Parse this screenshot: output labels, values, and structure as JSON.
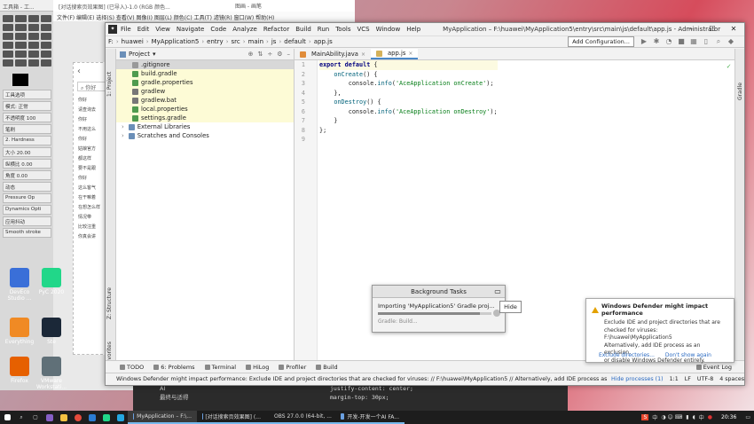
{
  "gimp": {
    "title": "工具箱 - 工...",
    "rows": [
      "工具选项",
      "模式: 正常",
      "不透明度 100",
      "笔刷",
      "2. Hardness",
      "大小 20.00",
      "纵横比 0.00",
      "角度 0.00",
      "动态",
      "Pressure Op",
      "Dynamics Opti",
      "应用抖动",
      "Smooth stroke"
    ]
  },
  "bg_editor": {
    "title": "[对话搜索页效果图] (已导入)-1.0 (RGB 颜色...",
    "menu": "文件(F) 编辑(E) 选择(S) 查看(V) 图像(I) 图层(L) 颜色(C) 工具(T) 滤镜(R) 窗口(W) 帮助(H)",
    "other_window": "图画 - 画笔",
    "chat_lines": [
      "你好",
      "请查询去",
      "你好",
      "不用这么",
      "你好",
      "姑娘官方",
      "都这样",
      "要不是跟",
      "你好",
      "这么客气",
      "在干嘛着",
      "在想怎么样",
      "情况带",
      "比较注重",
      "你真会讲"
    ]
  },
  "desktop_icons": [
    {
      "label": "DevEco Studio ...",
      "color": "#3a6fd8"
    },
    {
      "label": "PyC 2020",
      "color": "#21d789"
    },
    {
      "label": "Everything",
      "color": "#f08a24"
    },
    {
      "label": "Ste",
      "color": "#1b2838"
    },
    {
      "label": "Firefox",
      "color": "#e66000"
    },
    {
      "label": "VMware Workstati...",
      "color": "#607078"
    }
  ],
  "ide": {
    "menu": [
      "File",
      "Edit",
      "View",
      "Navigate",
      "Code",
      "Analyze",
      "Refactor",
      "Build",
      "Run",
      "Tools",
      "VCS",
      "Window",
      "Help"
    ],
    "title": "MyApplication – F:\\huawei\\MyApplication5\\entry\\src\\main\\js\\default\\app.js - Administrator",
    "breadcrumb": [
      "F:",
      "huawei",
      "MyApplication5",
      "entry",
      "src",
      "main",
      "js",
      "default",
      "app.js"
    ],
    "add_config": "Add Configuration...",
    "left_tabs": [
      "1: Project",
      "Z: Structure",
      "2: Favorites"
    ],
    "right_tab": "Gradle",
    "project": {
      "label": "Project",
      "tree": [
        {
          "name": ".gitignore",
          "color": "#999",
          "indent": 0,
          "cls": "sel"
        },
        {
          "name": "build.gradle",
          "color": "#4f9b4f",
          "indent": 0,
          "cls": "hl"
        },
        {
          "name": "gradle.properties",
          "color": "#4f9b4f",
          "indent": 0,
          "cls": "hl"
        },
        {
          "name": "gradlew",
          "color": "#777",
          "indent": 0,
          "cls": "hl"
        },
        {
          "name": "gradlew.bat",
          "color": "#777",
          "indent": 0,
          "cls": "hl"
        },
        {
          "name": "local.properties",
          "color": "#4f9b4f",
          "indent": 0,
          "cls": "hl"
        },
        {
          "name": "settings.gradle",
          "color": "#4f9b4f",
          "indent": 0,
          "cls": "hl"
        },
        {
          "name": "External Libraries",
          "color": "#6b8fb8",
          "indent": 0,
          "cls": ""
        },
        {
          "name": "Scratches and Consoles",
          "color": "#6b8fb8",
          "indent": 0,
          "cls": ""
        }
      ]
    },
    "tabs": [
      {
        "label": "MainAbility.java",
        "active": false
      },
      {
        "label": "app.js",
        "active": true
      }
    ],
    "line_numbers": [
      "1",
      "2",
      "3",
      "4",
      "5",
      "6",
      "7",
      "8",
      "9"
    ],
    "bottom_tabs": [
      "TODO",
      "6: Problems",
      "Terminal",
      "HiLog",
      "Profiler",
      "Build"
    ],
    "event_log": "Event Log",
    "status": {
      "message": "Windows Defender might impact performance: Exclude IDE and project directories that are checked for viruses: // F:\\huawei\\MyApplication5 // Alternatively, add IDE process as... (moments ago)",
      "hide": "Hide processes (1)",
      "pos": "1:1",
      "sep": "LF",
      "enc": "UTF-8",
      "indent": "4 spaces"
    }
  },
  "bg_tasks": {
    "title": "Background Tasks",
    "task": "Importing 'MyApplication5' Gradle proj...",
    "sub": "Gradle: Build...",
    "progress": 0.9,
    "hide_tooltip": "Hide"
  },
  "defender": {
    "title": "Windows Defender might impact performance",
    "lines": [
      "Exclude IDE and project directories that are",
      "checked for viruses:",
      "F:\\huawei\\MyApplication5",
      "Alternatively, add IDE process as an exclusion,",
      "or disable Windows Defender entirely."
    ],
    "exclude": "Exclude directories...",
    "dont_show": "Don't show again"
  },
  "under_fragment": {
    "css_lines": [
      "justify-content: center;",
      "margin-top: 30px;"
    ],
    "left_lines": [
      "AI",
      "最终与适得"
    ]
  },
  "taskbar": {
    "windows": [
      {
        "label": "MyApplication – F:\\...",
        "active": true
      },
      {
        "label": "[对话搜索页效果图] (...",
        "active": false
      },
      {
        "label": "OBS 27.0.0 (64-bit, ...",
        "active": false
      },
      {
        "label": "开发-开发一个AI FA...",
        "active": false
      }
    ],
    "tray_text": "中",
    "clock": "20:36"
  }
}
